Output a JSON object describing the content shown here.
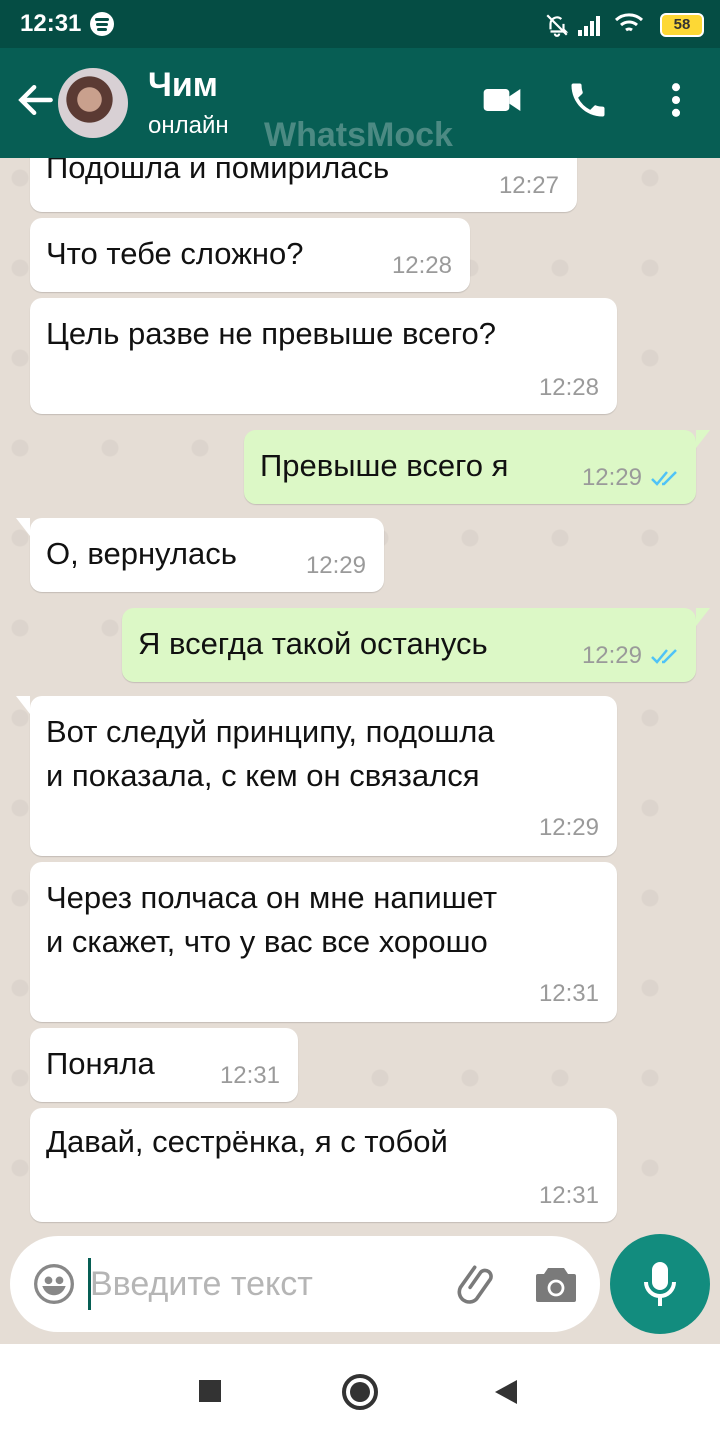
{
  "status_bar": {
    "time": "12:31",
    "battery": "58"
  },
  "header": {
    "contact_name": "Чим",
    "contact_status": "онлайн",
    "watermark": "WhatsMock"
  },
  "messages": [
    {
      "direction": "in",
      "lines": [
        "Подошла и помирилась"
      ],
      "time": "12:27"
    },
    {
      "direction": "in",
      "lines": [
        "Что тебе сложно?"
      ],
      "time": "12:28"
    },
    {
      "direction": "in",
      "lines": [
        "Цель разве не превыше всего?"
      ],
      "time": "12:28"
    },
    {
      "direction": "out",
      "lines": [
        "Превыше всего я"
      ],
      "time": "12:29",
      "read": true
    },
    {
      "direction": "in",
      "lines": [
        "О, вернулась"
      ],
      "time": "12:29"
    },
    {
      "direction": "out",
      "lines": [
        "Я всегда такой останусь"
      ],
      "time": "12:29",
      "read": true
    },
    {
      "direction": "in",
      "lines": [
        "Вот следуй принципу, подошла",
        "и показала, с кем он связался"
      ],
      "time": "12:29"
    },
    {
      "direction": "in",
      "lines": [
        "Через полчаса он мне напишет",
        "и скажет, что у вас все хорошо"
      ],
      "time": "12:31"
    },
    {
      "direction": "in",
      "lines": [
        "Поняла"
      ],
      "time": "12:31"
    },
    {
      "direction": "in",
      "lines": [
        "Давай, сестрёнка, я с тобой"
      ],
      "time": "12:31"
    }
  ],
  "composer": {
    "placeholder": "Введите текст"
  },
  "colors": {
    "header": "#075e54",
    "status_bar": "#054d44",
    "incoming_bubble": "#ffffff",
    "outgoing_bubble": "#dcf8c6",
    "read_ticks": "#4fc3f7",
    "mic_button": "#128c7e",
    "chat_background": "#e5ddd5"
  }
}
